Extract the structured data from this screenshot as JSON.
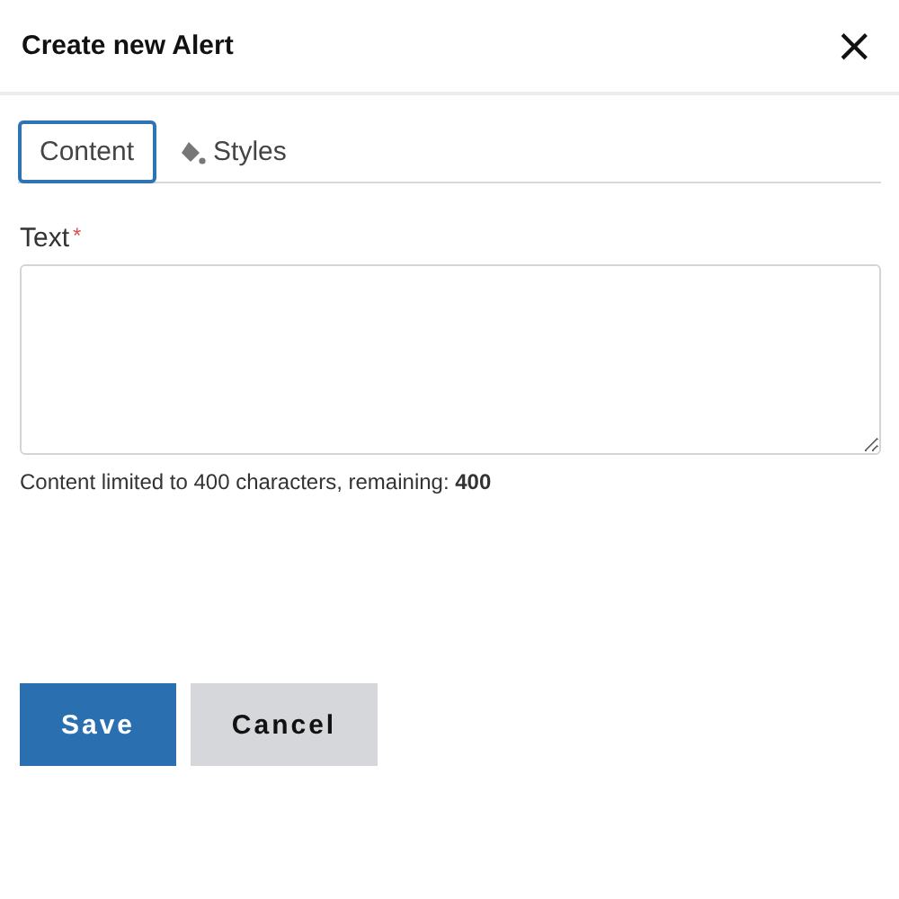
{
  "dialog": {
    "title": "Create new Alert",
    "close": "×"
  },
  "tabs": [
    {
      "label": "Content",
      "selected": true,
      "icon": false
    },
    {
      "label": "Styles",
      "selected": false,
      "icon": true
    }
  ],
  "field": {
    "label": "Text",
    "required_mark": "*",
    "helper": "Content limited to 400 characters, remaining: **400**"
  },
  "buttons": [
    {
      "label": "Save",
      "kind": "primary"
    },
    {
      "label": "Cancel",
      "kind": "secondary"
    }
  ]
}
